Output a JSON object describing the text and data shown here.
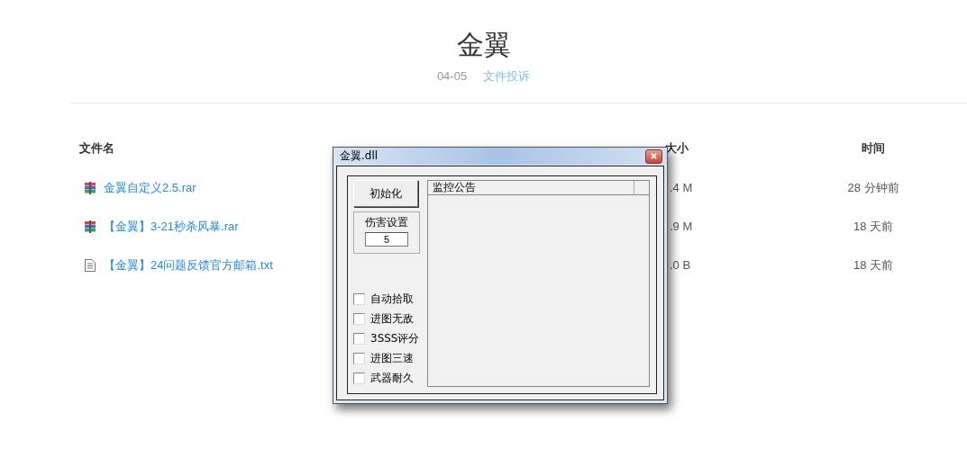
{
  "page": {
    "title": "金翼",
    "date": "04-05",
    "report_link": "文件投诉"
  },
  "file_table": {
    "columns": [
      "文件名",
      "大小",
      "时间"
    ],
    "rows": [
      {
        "kind": "archive",
        "name": "金翼自定义2.5.rar",
        "size": ".4 M",
        "time": "28 分钟前"
      },
      {
        "kind": "archive",
        "name": "【金翼】3-21秒杀风暴.rar",
        "size": ".9 M",
        "time": "18 天前"
      },
      {
        "kind": "text",
        "name": "【金翼】24问题反馈官方邮箱.txt",
        "size": ".0 B",
        "time": "18 天前"
      }
    ]
  },
  "dialog": {
    "title": "金翼.dll",
    "init_button": "初始化",
    "damage_group": {
      "label": "伤害设置",
      "value": "5"
    },
    "options": [
      {
        "label": "自动拾取",
        "checked": false
      },
      {
        "label": "进图无敌",
        "checked": false
      },
      {
        "label": "3SSS评分",
        "checked": false
      },
      {
        "label": "进图三速",
        "checked": false
      },
      {
        "label": "武器耐久",
        "checked": false
      }
    ],
    "list": {
      "column": "监控公告"
    }
  }
}
